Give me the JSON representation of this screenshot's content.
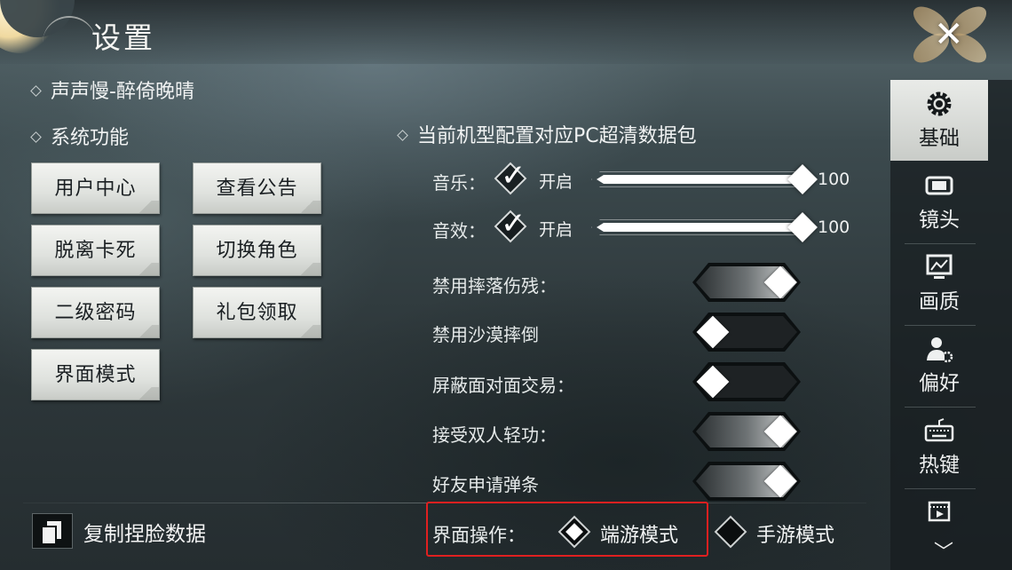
{
  "header": {
    "title": "设置",
    "close_icon": "close-x-icon"
  },
  "left": {
    "account_name": "声声慢-醉倚晚晴",
    "system_heading": "系统功能",
    "buttons": [
      {
        "label": "用户中心"
      },
      {
        "label": "查看公告"
      },
      {
        "label": "脱离卡死"
      },
      {
        "label": "切换角色"
      },
      {
        "label": "二级密码"
      },
      {
        "label": "礼包领取"
      },
      {
        "label": "界面模式"
      }
    ],
    "copy_face_label": "复制捏脸数据"
  },
  "center": {
    "package_heading": "当前机型配置对应PC超清数据包",
    "music": {
      "label": "音乐：",
      "toggle_text": "开启",
      "checked": true,
      "value": 100
    },
    "sfx": {
      "label": "音效：",
      "toggle_text": "开启",
      "checked": true,
      "value": 100
    },
    "toggles": [
      {
        "label": "禁用摔落伤残：",
        "on": true
      },
      {
        "label": "禁用沙漠摔倒",
        "on": false
      },
      {
        "label": "屏蔽面对面交易：",
        "on": false
      },
      {
        "label": "接受双人轻功：",
        "on": true
      },
      {
        "label": "好友申请弹条",
        "on": true
      }
    ],
    "ui_mode": {
      "label": "界面操作：",
      "options": [
        {
          "label": "端游模式",
          "selected": true
        },
        {
          "label": "手游模式",
          "selected": false
        }
      ],
      "highlight_color": "#e02020"
    }
  },
  "tabs": [
    {
      "label": "基础",
      "icon": "gear-icon",
      "active": true
    },
    {
      "label": "镜头",
      "icon": "camera-frame-icon",
      "active": false
    },
    {
      "label": "画质",
      "icon": "monitor-icon",
      "active": false
    },
    {
      "label": "偏好",
      "icon": "user-gear-icon",
      "active": false
    },
    {
      "label": "热键",
      "icon": "keyboard-icon",
      "active": false
    },
    {
      "label": "",
      "icon": "film-icon",
      "active": false
    }
  ]
}
